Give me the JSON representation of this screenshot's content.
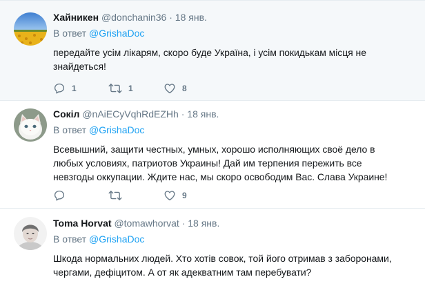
{
  "tweets": [
    {
      "author": "Хайникен",
      "handle": "@donchanin36",
      "separator": "·",
      "time": "18 янв.",
      "reply_prefix": "В ответ",
      "reply_mention": "@GrishaDoc",
      "text_lines": [
        "передайте усім лікарям, скоро буде Україна, і усім покидькам місця не",
        "знайдеться!"
      ],
      "replies": "1",
      "retweets": "1",
      "likes": "8",
      "avatar": "sunflower-field"
    },
    {
      "author": "Сокіл",
      "handle": "@nAiECyVqhRdEZHh",
      "separator": "·",
      "time": "18 янв.",
      "reply_prefix": "В ответ",
      "reply_mention": "@GrishaDoc",
      "text_lines": [
        "Всевышний, защити честных, умных, хорошо исполняющих своё дело в",
        "любых условиях, патриотов Украины! Дай им терпения пережить все",
        "невзгоды оккупации. Ждите нас, мы скоро освободим Вас. Слава Украине!"
      ],
      "replies": "",
      "retweets": "",
      "likes": "9",
      "avatar": "white-kitten"
    },
    {
      "author": "Toma Horvat",
      "handle": "@tomawhorvat",
      "separator": "·",
      "time": "18 янв.",
      "reply_prefix": "В ответ",
      "reply_mention": "@GrishaDoc",
      "text_lines": [
        "Шкода нормальних людей. Хто хотів совок,  той його отримав з заборонами,",
        "чергами,  дефіцитом. А от як адекватним там перебувати?"
      ],
      "avatar": "portrait-photo"
    }
  ],
  "icons": {
    "reply": "reply-icon",
    "retweet": "retweet-icon",
    "like": "like-icon"
  },
  "colors": {
    "link": "#1da1f2",
    "muted": "#657786",
    "text": "#14171a",
    "divider": "#e6ecf0"
  }
}
